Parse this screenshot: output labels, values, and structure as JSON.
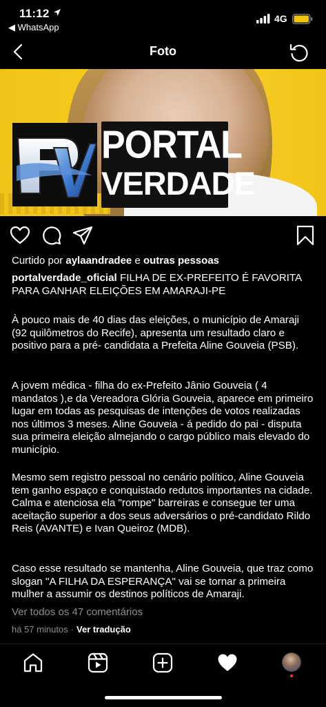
{
  "status_bar": {
    "time": "11:12",
    "back_app": "◀ WhatsApp",
    "network": "4G",
    "battery_color": "#f2c40e"
  },
  "nav": {
    "title": "Foto"
  },
  "photo": {
    "banner_line1": "PORTAL",
    "banner_line2": "VERDADE",
    "background_color": "#f2c418"
  },
  "likes": {
    "prefix": "Curtido por",
    "user": "aylaandradee",
    "connector": "e",
    "others": "outras pessoas"
  },
  "post": {
    "username": "portalverdade_oficial",
    "headline": "FILHA DE EX-PREFEITO É FAVORITA PARA GANHAR ELEIÇÕES EM AMARAJI-PE",
    "paragraphs": [
      "À pouco mais de 40 dias das eleições, o município de Amaraji (92 quilômetros do Recife), apresenta um resultado claro e positivo para a pré- candidata a Prefeita Aline Gouveia (PSB).",
      "A jovem médica - filha do ex-Prefeito Jânio Gouveia ( 4 mandatos ),e da Vereadora Glória Gouveia, aparece em primeiro lugar em todas as pesquisas de intenções de votos realizadas nos últimos 3 meses. Aline Gouveia - á pedido do pai - disputa sua primeira eleição almejando o cargo público mais elevado do município.",
      "Mesmo sem registro pessoal no cenário político, Aline Gouveia tem ganho espaço e conquistado redutos importantes na cidade. Calma e atenciosa ela \"rompe\" barreiras e consegue ter uma aceitação superior a dos seus adversários o pré-candidato Rildo Reis (AVANTE) e Ivan Queiroz (MDB).",
      "Caso esse resultado se mantenha, Aline Gouveia, que traz como slogan \"A FILHA DA ESPERANÇA\" vai se tornar a primeira mulher a assumir os destinos políticos de Amaraji."
    ],
    "view_comments": "Ver todos os 47 comentários",
    "time_ago": "há 57 minutos",
    "separator": "·",
    "translate": "Ver tradução"
  },
  "icons": {
    "like": "heart-outline-icon",
    "comment": "comment-icon",
    "share": "paper-plane-icon",
    "save": "bookmark-icon",
    "back": "chevron-left-icon",
    "refresh": "refresh-icon",
    "home": "home-icon",
    "reels": "reels-icon",
    "create": "plus-square-icon",
    "activity": "heart-filled-icon",
    "profile": "profile-avatar"
  }
}
